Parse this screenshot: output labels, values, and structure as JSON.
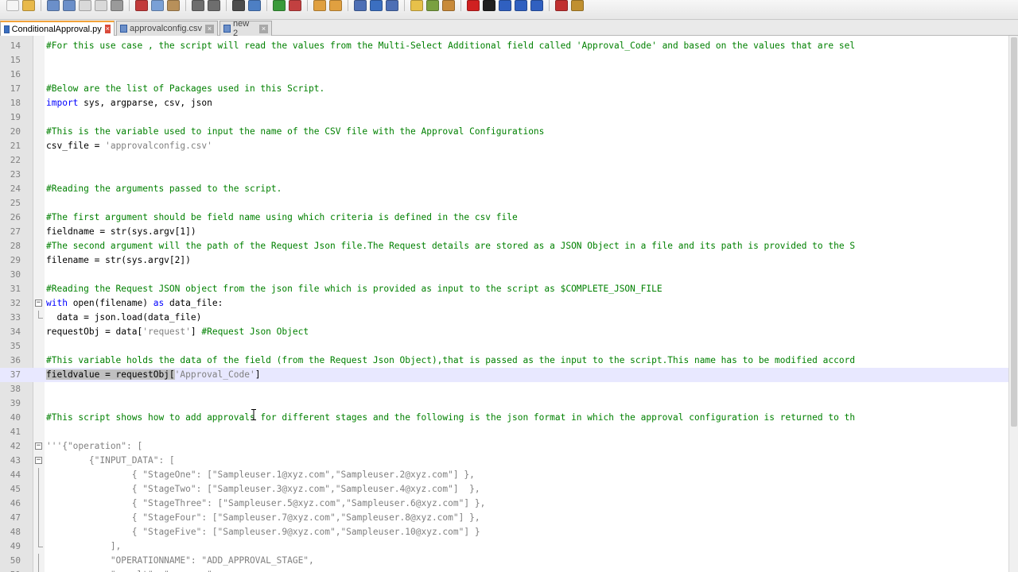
{
  "toolbar": {
    "buttons": [
      {
        "icon": "new-file-icon",
        "color": "#f5f5f5"
      },
      {
        "icon": "open-folder-icon",
        "color": "#e8b94a"
      },
      {
        "icon": "save-icon",
        "color": "#6b8fc9"
      },
      {
        "icon": "save-all-icon",
        "color": "#6b8fc9"
      },
      {
        "icon": "close-icon",
        "color": "#d9d9d9"
      },
      {
        "icon": "close-all-icon",
        "color": "#d9d9d9"
      },
      {
        "icon": "print-icon",
        "color": "#9a9a9a"
      },
      {
        "icon": "cut-icon",
        "color": "#c23b3b"
      },
      {
        "icon": "copy-icon",
        "color": "#7aa0d6"
      },
      {
        "icon": "paste-icon",
        "color": "#b8905a"
      },
      {
        "icon": "undo-icon",
        "color": "#6e6e6e"
      },
      {
        "icon": "redo-icon",
        "color": "#6e6e6e"
      },
      {
        "icon": "find-icon",
        "color": "#4d4d4d"
      },
      {
        "icon": "replace-icon",
        "color": "#4d7fc4"
      },
      {
        "icon": "zoom-in-icon",
        "color": "#3a9b3a"
      },
      {
        "icon": "zoom-out-icon",
        "color": "#c24040"
      },
      {
        "icon": "sync-vertical-icon",
        "color": "#e0a040"
      },
      {
        "icon": "sync-horizontal-icon",
        "color": "#e0a040"
      },
      {
        "icon": "word-wrap-icon",
        "color": "#4d6fb5"
      },
      {
        "icon": "show-all-chars-icon",
        "color": "#3b6fc0"
      },
      {
        "icon": "indent-guide-icon",
        "color": "#4d6fb5"
      },
      {
        "icon": "user-language-icon",
        "color": "#e7c14a"
      },
      {
        "icon": "doc-map-icon",
        "color": "#7aa040"
      },
      {
        "icon": "function-list-icon",
        "color": "#c88a3a"
      },
      {
        "icon": "record-macro-icon",
        "color": "#d02020"
      },
      {
        "icon": "stop-macro-icon",
        "color": "#202020"
      },
      {
        "icon": "play-macro-icon",
        "color": "#3060c0"
      },
      {
        "icon": "play-multiple-icon",
        "color": "#3060c0"
      },
      {
        "icon": "save-macro-icon",
        "color": "#3060c0"
      },
      {
        "icon": "spell-check-icon",
        "color": "#c03030"
      },
      {
        "icon": "spell-settings-icon",
        "color": "#c09030"
      }
    ]
  },
  "tabs": [
    {
      "label": "ConditionalApproval.py",
      "active": true,
      "icon": "python-file-icon",
      "close_color": "#d94a3a"
    },
    {
      "label": "approvalconfig.csv",
      "active": false,
      "icon": "csv-file-icon",
      "close_color": "#a8a8a8"
    },
    {
      "label": "new  2",
      "active": false,
      "icon": "new-file-icon",
      "close_color": "#a8a8a8"
    }
  ],
  "editor": {
    "current_line": 37,
    "lines": [
      {
        "n": "14",
        "parts": [
          {
            "t": "#For this use case , the script will read the values from the Multi-Select Additional field called 'Approval_Code' and based on the values that are sel",
            "c": "cmt"
          }
        ]
      },
      {
        "n": "15",
        "parts": []
      },
      {
        "n": "16",
        "parts": []
      },
      {
        "n": "17",
        "parts": [
          {
            "t": "#Below are the list of Packages used in this Script.",
            "c": "cmt"
          }
        ]
      },
      {
        "n": "18",
        "parts": [
          {
            "t": "import",
            "c": "kw"
          },
          {
            "t": " sys, argparse, csv, json",
            "c": ""
          }
        ]
      },
      {
        "n": "19",
        "parts": []
      },
      {
        "n": "20",
        "parts": [
          {
            "t": "#This is the variable used to input the name of the CSV file with the Approval Configurations",
            "c": "cmt"
          }
        ]
      },
      {
        "n": "21",
        "parts": [
          {
            "t": "csv_file = ",
            "c": ""
          },
          {
            "t": "'approvalconfig.csv'",
            "c": "str"
          }
        ]
      },
      {
        "n": "22",
        "parts": []
      },
      {
        "n": "23",
        "parts": []
      },
      {
        "n": "24",
        "parts": [
          {
            "t": "#Reading the arguments passed to the script.",
            "c": "cmt"
          }
        ]
      },
      {
        "n": "25",
        "parts": []
      },
      {
        "n": "26",
        "parts": [
          {
            "t": "#The first argument should be field name using which criteria is defined in the csv file",
            "c": "cmt"
          }
        ]
      },
      {
        "n": "27",
        "parts": [
          {
            "t": "fieldname = str(sys.argv[1])",
            "c": ""
          }
        ]
      },
      {
        "n": "28",
        "parts": [
          {
            "t": "#The second argument will the path of the Request Json file.The Request details are stored as a JSON Object in a file and its path is provided to the S",
            "c": "cmt"
          }
        ]
      },
      {
        "n": "29",
        "parts": [
          {
            "t": "filename = str(sys.argv[2])",
            "c": ""
          }
        ]
      },
      {
        "n": "30",
        "parts": []
      },
      {
        "n": "31",
        "parts": [
          {
            "t": "#Reading the Request JSON object from the json file which is provided as input to the script as $COMPLETE_JSON_FILE",
            "c": "cmt"
          }
        ]
      },
      {
        "n": "32",
        "fold": "minus",
        "parts": [
          {
            "t": "with",
            "c": "kw"
          },
          {
            "t": " open(filename) ",
            "c": ""
          },
          {
            "t": "as",
            "c": "kw"
          },
          {
            "t": " data_file:",
            "c": ""
          }
        ]
      },
      {
        "n": "33",
        "fold": "end",
        "parts": [
          {
            "t": "  data = json.load(data_file)",
            "c": ""
          }
        ]
      },
      {
        "n": "34",
        "parts": [
          {
            "t": "requestObj = data[",
            "c": ""
          },
          {
            "t": "'request'",
            "c": "str"
          },
          {
            "t": "] ",
            "c": ""
          },
          {
            "t": "#Request Json Object",
            "c": "cmt"
          }
        ]
      },
      {
        "n": "35",
        "parts": []
      },
      {
        "n": "36",
        "parts": [
          {
            "t": "#This variable holds the data of the field (from the Request Json Object),that is passed as the input to the script.This name has to be modified accord",
            "c": "cmt"
          }
        ]
      },
      {
        "n": "37",
        "parts": [
          {
            "t": "fieldvalue = requestObj[",
            "c": "sel"
          },
          {
            "t": "'Approval_Code'",
            "c": "str"
          },
          {
            "t": "]",
            "c": ""
          }
        ]
      },
      {
        "n": "38",
        "parts": []
      },
      {
        "n": "39",
        "parts": []
      },
      {
        "n": "40",
        "parts": [
          {
            "t": "#This script shows how to add approvals for different stages and the following is the json format in which the approval configuration is returned to th",
            "c": "cmt"
          }
        ]
      },
      {
        "n": "41",
        "parts": []
      },
      {
        "n": "42",
        "fold": "minus",
        "parts": [
          {
            "t": "'''{\"operation\": [",
            "c": "str"
          }
        ]
      },
      {
        "n": "43",
        "fold": "minus",
        "parts": [
          {
            "t": "        {\"INPUT_DATA\": [",
            "c": "str"
          }
        ]
      },
      {
        "n": "44",
        "fold": "line",
        "parts": [
          {
            "t": "                { \"StageOne\": [\"Sampleuser.1@xyz.com\",\"Sampleuser.2@xyz.com\"] },",
            "c": "str"
          }
        ]
      },
      {
        "n": "45",
        "fold": "line",
        "parts": [
          {
            "t": "                { \"StageTwo\": [\"Sampleuser.3@xyz.com\",\"Sampleuser.4@xyz.com\"]  },",
            "c": "str"
          }
        ]
      },
      {
        "n": "46",
        "fold": "line",
        "parts": [
          {
            "t": "                { \"StageThree\": [\"Sampleuser.5@xyz.com\",\"Sampleuser.6@xyz.com\"] },",
            "c": "str"
          }
        ]
      },
      {
        "n": "47",
        "fold": "line",
        "parts": [
          {
            "t": "                { \"StageFour\": [\"Sampleuser.7@xyz.com\",\"Sampleuser.8@xyz.com\"] },",
            "c": "str"
          }
        ]
      },
      {
        "n": "48",
        "fold": "line",
        "parts": [
          {
            "t": "                { \"StageFive\": [\"Sampleuser.9@xyz.com\",\"Sampleuser.10@xyz.com\"] }",
            "c": "str"
          }
        ]
      },
      {
        "n": "49",
        "fold": "end",
        "parts": [
          {
            "t": "            ],",
            "c": "str"
          }
        ]
      },
      {
        "n": "50",
        "fold": "line",
        "parts": [
          {
            "t": "            \"OPERATIONNAME\": \"ADD_APPROVAL_STAGE\",",
            "c": "str"
          }
        ]
      },
      {
        "n": "51",
        "fold": "line",
        "parts": [
          {
            "t": "            \"result\": \"success\",",
            "c": "str"
          }
        ]
      }
    ]
  }
}
